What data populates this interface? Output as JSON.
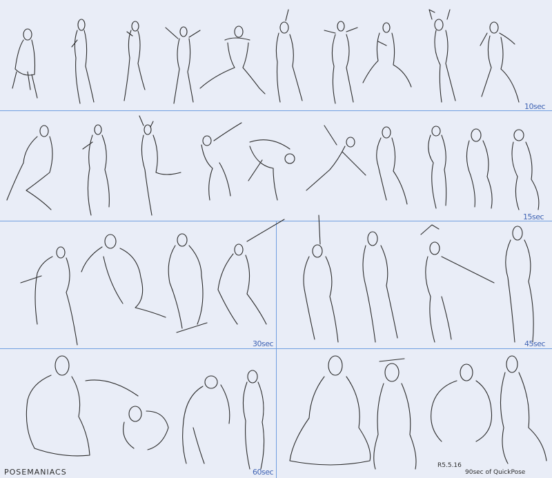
{
  "sheet": {
    "background": "#e9edf7",
    "rule_color": "#6f9ee0",
    "ink_color": "#2a2a2a",
    "label_color": "#3f63b3"
  },
  "rows": [
    {
      "time_label": "10sec",
      "figure_count": 10
    },
    {
      "time_label": "15sec",
      "figure_count": 11
    },
    {
      "left_label": "30sec",
      "right_label": "45sec",
      "figure_count": 8
    },
    {
      "left_label": "60sec",
      "right_label": "90sec",
      "figure_count": 8
    }
  ],
  "footer": {
    "signature": "POSEMANIACS",
    "date": "R5.5.16",
    "note": "90sec of QuickPose"
  }
}
